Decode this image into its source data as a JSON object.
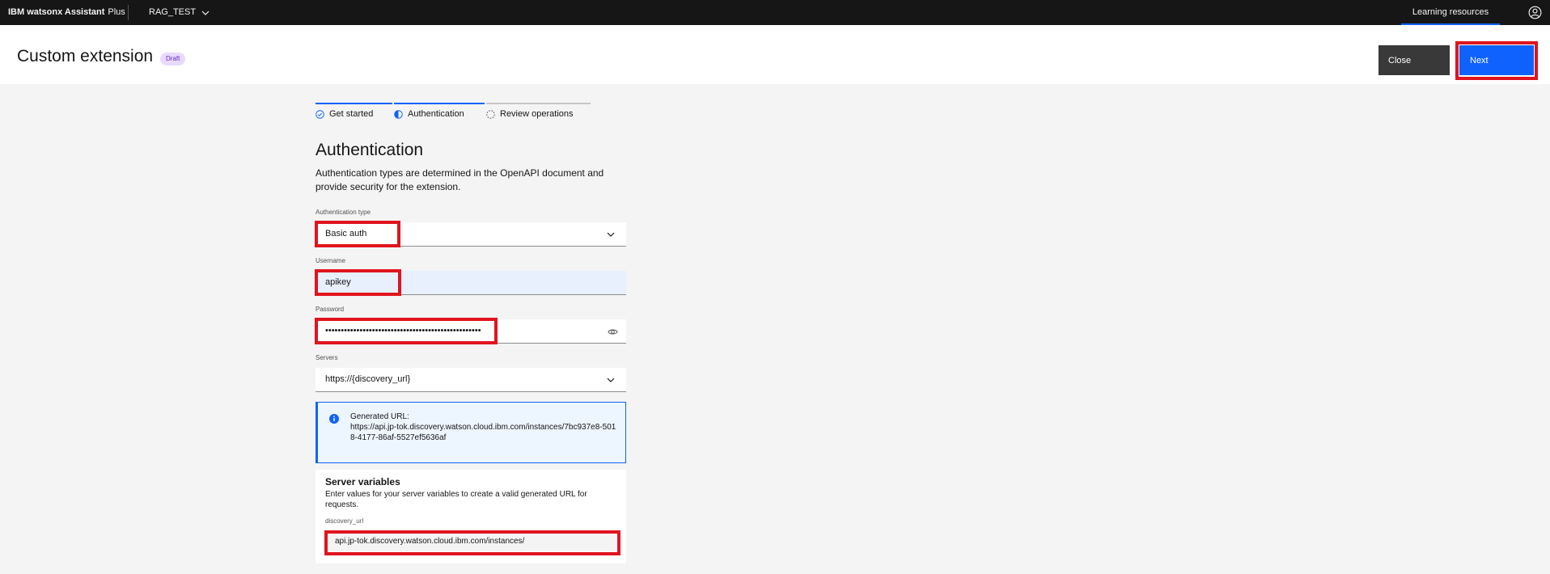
{
  "topbar": {
    "brand": "IBM watsonx Assistant",
    "plan": "Plus",
    "workspace": "RAG_TEST",
    "learning": "Learning resources"
  },
  "header": {
    "title": "Custom extension",
    "badge": "Draft",
    "close_label": "Close",
    "next_label": "Next"
  },
  "steps": [
    {
      "label": "Get started",
      "state": "complete"
    },
    {
      "label": "Authentication",
      "state": "current"
    },
    {
      "label": "Review operations",
      "state": "incomplete"
    }
  ],
  "auth": {
    "title": "Authentication",
    "description": "Authentication types are determined in the OpenAPI document and provide security for the extension.",
    "type_label": "Authentication type",
    "type_value": "Basic auth",
    "username_label": "Username",
    "username_value": "apikey",
    "password_label": "Password",
    "password_value": "••••••••••••••••••••••••••••••••••••••••••••••••••",
    "servers_label": "Servers",
    "servers_value": "https://{discovery_url}"
  },
  "notice": {
    "heading": "Generated URL:",
    "url": "https://api.jp-tok.discovery.watson.cloud.ibm.com/instances/7bc937e8-5018-4177-86af-5527ef5636af"
  },
  "server_vars": {
    "title": "Server variables",
    "description": "Enter values for your server variables to create a valid generated URL for requests.",
    "var_label": "discovery_url",
    "var_value": "api.jp-tok.discovery.watson.cloud.ibm.com/instances/"
  },
  "colors": {
    "accent": "#0f62fe",
    "highlight": "#e0141e",
    "badge_bg": "#e8daff"
  }
}
